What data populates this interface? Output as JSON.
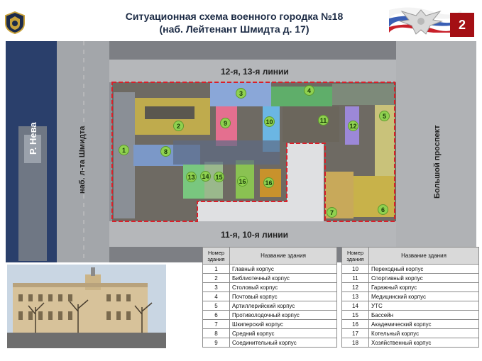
{
  "header": {
    "title_line1": "Ситуационная схема военного городка №18",
    "title_line2": "(наб. Лейтенант Шмидта д. 17)",
    "page_number": "2"
  },
  "map": {
    "street_top": "12-я, 13-я линии",
    "street_bottom": "11-я, 10-я линии",
    "river": "Р. Нева",
    "embankment": "наб. л-та Шмидта",
    "prospect": "Большой проспект",
    "building_numbers": [
      "1",
      "2",
      "3",
      "4",
      "5",
      "6",
      "7",
      "8",
      "9",
      "10",
      "11",
      "12",
      "13",
      "14",
      "15",
      "16",
      "16"
    ],
    "colors": {
      "boundary": "#d9202a",
      "marker": "#8fd14f",
      "river": "#2a3f6b"
    }
  },
  "tables": {
    "left": {
      "headers": [
        "Номер здания",
        "Название здания"
      ],
      "rows": [
        [
          "1",
          "Главный корпус"
        ],
        [
          "2",
          "Библиотечный корпус"
        ],
        [
          "3",
          "Столовый корпус"
        ],
        [
          "4",
          "Почтовый корпус"
        ],
        [
          "5",
          "Артиллерийский корпус"
        ],
        [
          "6",
          "Противолодочный корпус"
        ],
        [
          "7",
          "Шкиперский корпус"
        ],
        [
          "8",
          "Средний корпус"
        ],
        [
          "9",
          "Соединительный корпус"
        ]
      ]
    },
    "right": {
      "headers": [
        "Номер здания",
        "Название здания"
      ],
      "rows": [
        [
          "10",
          "Переходный корпус"
        ],
        [
          "11",
          "Спортивный корпус"
        ],
        [
          "12",
          "Гаражный корпус"
        ],
        [
          "13",
          "Медицинский корпус"
        ],
        [
          "14",
          "УТС"
        ],
        [
          "15",
          "Бассейн"
        ],
        [
          "16",
          "Академический корпус"
        ],
        [
          "17",
          "Котельный корпус"
        ],
        [
          "18",
          "Хозяйственный корпус"
        ]
      ]
    }
  }
}
